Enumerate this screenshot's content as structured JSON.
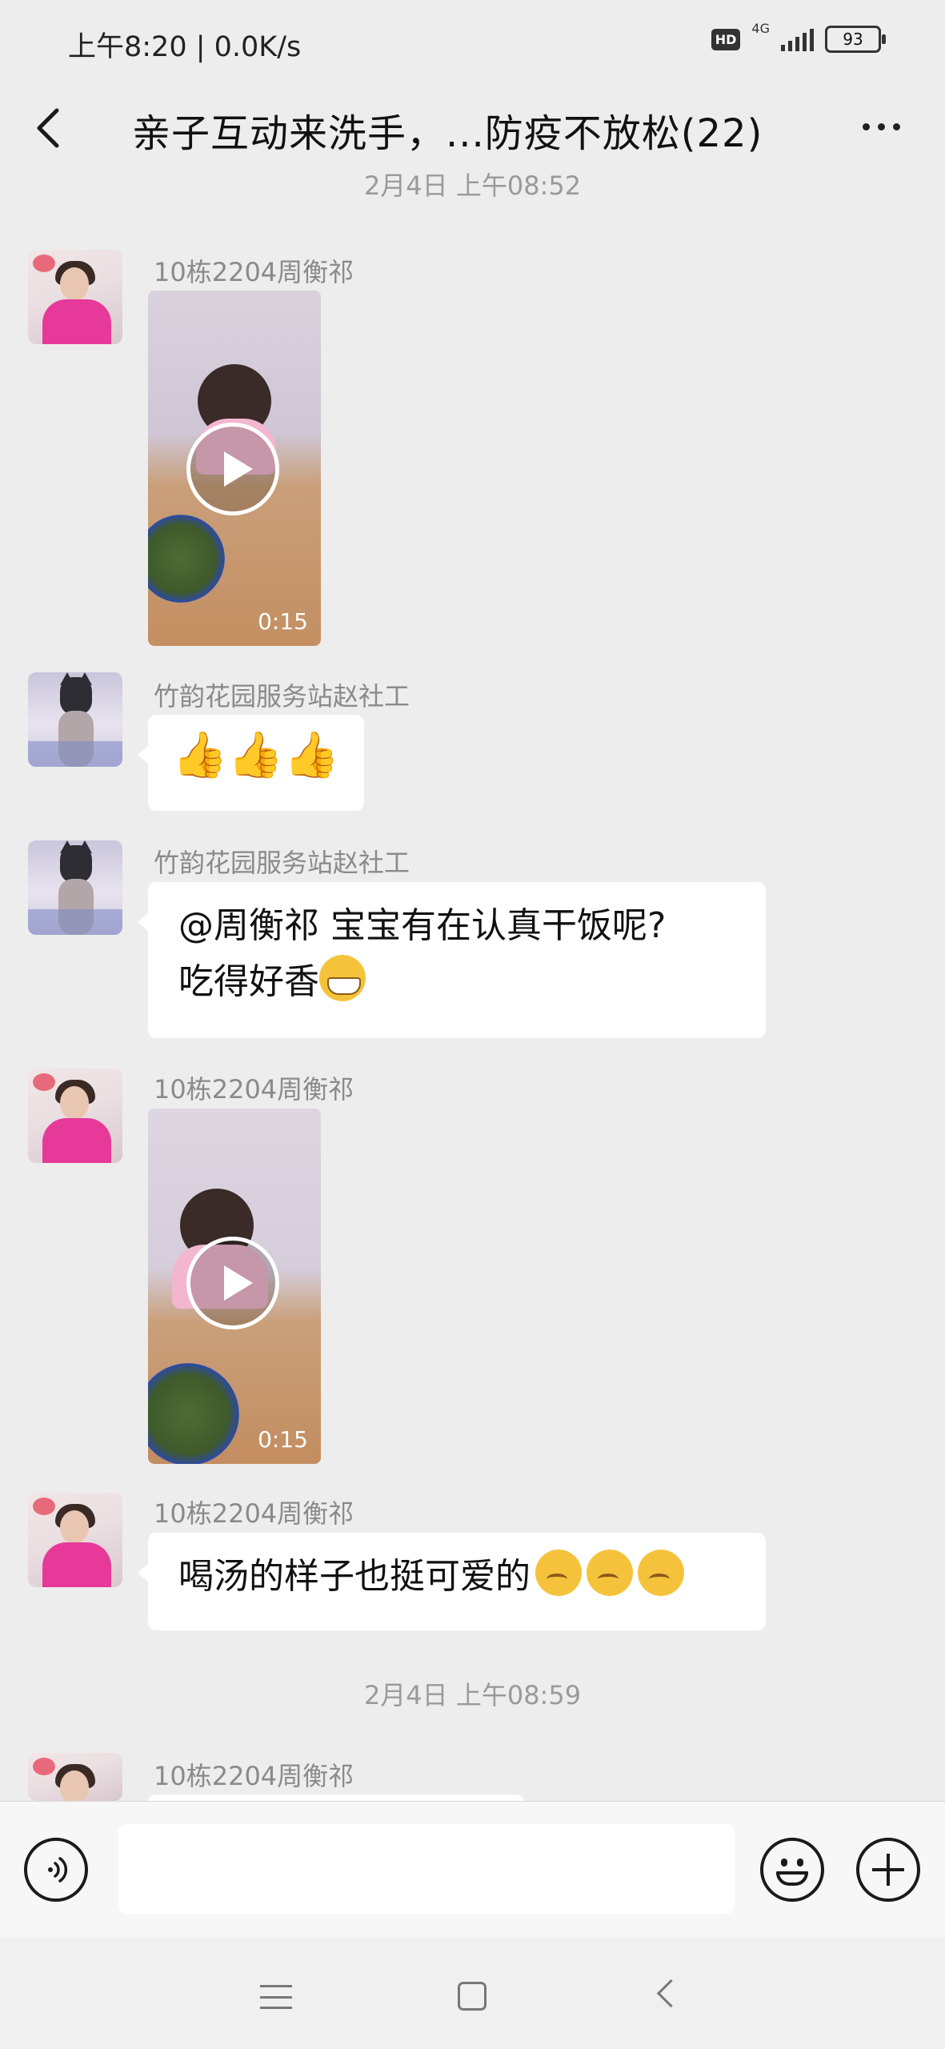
{
  "status_bar": {
    "time_speed": "上午8:20 | 0.0K/s",
    "hd": "HD",
    "network": "4G",
    "battery": "93"
  },
  "header": {
    "title": "亲子互动来洗手，...防疫不放松(22)"
  },
  "timestamps": [
    "2月4日 上午08:52",
    "2月4日 上午08:59"
  ],
  "messages": [
    {
      "sender": "10栋2204周衡祁",
      "type": "video",
      "duration": "0:15"
    },
    {
      "sender": "竹韵花园服务站赵社工",
      "type": "emoji",
      "emoji": "👍👍👍"
    },
    {
      "sender": "竹韵花园服务站赵社工",
      "type": "text",
      "line1": "@周衡祁  宝宝有在认真干饭呢?",
      "line2": "吃得好香"
    },
    {
      "sender": "10栋2204周衡祁",
      "type": "video",
      "duration": "0:15"
    },
    {
      "sender": "10栋2204周衡祁",
      "type": "text",
      "text": "喝汤的样子也挺可爱的"
    },
    {
      "sender": "10栋2204周衡祁",
      "type": "partial"
    }
  ],
  "colors": {
    "background": "#ededed",
    "bubble": "#ffffff",
    "sender_name": "#8a8a8a",
    "timestamp": "#9a9a9a"
  },
  "icons": {
    "back": "chevron-left-icon",
    "more": "more-dots-icon",
    "voice": "voice-icon",
    "emoji": "emoji-icon",
    "plus": "plus-icon"
  }
}
